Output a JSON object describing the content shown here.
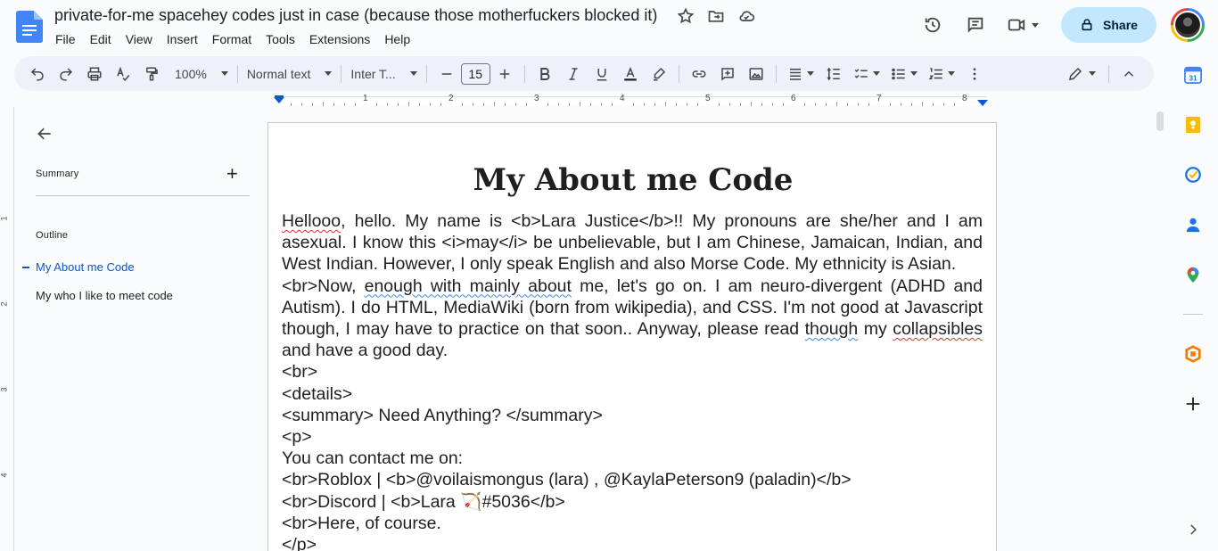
{
  "header": {
    "doc_title": "private-for-me spacehey codes just in case (because those motherfuckers blocked it)",
    "menu": [
      "File",
      "Edit",
      "View",
      "Insert",
      "Format",
      "Tools",
      "Extensions",
      "Help"
    ],
    "share_label": "Share"
  },
  "toolbar": {
    "zoom": "100%",
    "style": "Normal text",
    "font": "Inter T...",
    "font_size": "15"
  },
  "ruler": {
    "numbers": [
      "1",
      "2",
      "3",
      "4",
      "5",
      "6",
      "7",
      "8"
    ],
    "vertical_numbers": [
      "1",
      "2",
      "3",
      "4"
    ]
  },
  "outline_panel": {
    "summary_label": "Summary",
    "outline_label": "Outline",
    "items": [
      "My About me Code",
      "My who I like to meet code"
    ]
  },
  "document": {
    "heading": "My About me Code",
    "para1": {
      "w_hellooo": "Hellooo",
      "rest": ", hello. My name is <b>Lara Justice</b>!! My pronouns are she/her and I am asexual. I know this <i>may</i> be unbelievable, but I am Chinese, Jamaican, Indian, and West Indian. However, I only speak English and also Morse Code. My ethnicity is Asian."
    },
    "para2": {
      "a": "<br>Now, ",
      "enough": "enough with mainly about",
      "b": " me, let's go on. I am neuro-divergent (ADHD and Autism). I do HTML, MediaWiki (born from wikipedia), and CSS. I'm not good at Javascript though, I may have to practice on that soon.. Anyway, please read ",
      "though": "though",
      "c": " my ",
      "collapsibles": "collapsibles",
      "d": " and have a good day."
    },
    "lines": [
      "<br>",
      "<details>",
      "<summary> Need Anything? </summary>",
      "<p>",
      "You can contact me on:",
      "<br>Roblox | <b>@voilaismongus (lara) , @KaylaPeterson9 (paladin)</b>"
    ],
    "discord_a": "<br>Discord | <b>Lara ",
    "discord_emoji": "🏹",
    "discord_b": "#5036</b>",
    "lines2": [
      "<br>Here, of course.",
      "</p>"
    ]
  },
  "colors": {
    "accent": "#0b57d0",
    "share_bg": "#c2e7ff",
    "toolbar_bg": "#edf2fa",
    "page_bg": "#f9fbfd"
  },
  "icons": {
    "header": [
      "star-icon",
      "move-folder-icon",
      "cloud-status-icon",
      "history-icon",
      "comments-icon",
      "meet-icon",
      "lock-icon"
    ],
    "side_panel": [
      "calendar-icon",
      "keep-icon",
      "tasks-icon",
      "contacts-icon",
      "maps-icon",
      "office-icon",
      "add-icon",
      "chevron-right-icon"
    ]
  }
}
